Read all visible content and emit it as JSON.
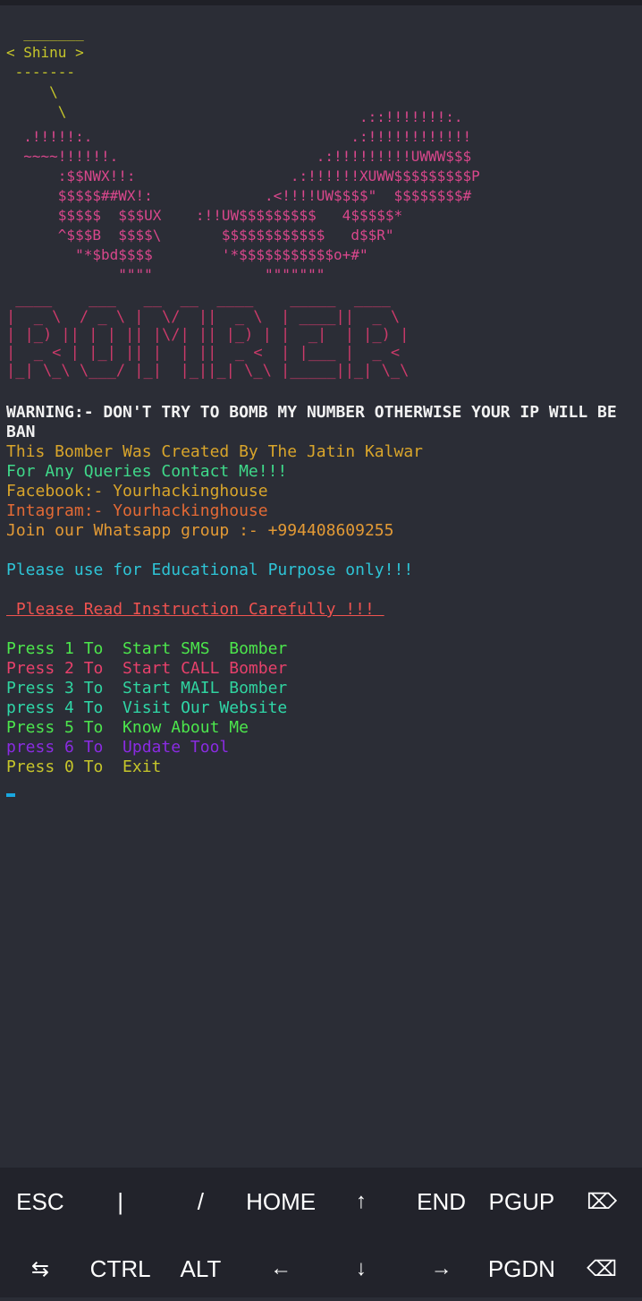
{
  "banner": {
    "cow": "  _______\n< Shinu >\n -------\n     \\\n      \\",
    "skull": "                                         .::!!!!!!!:.\n  .!!!!!:.                              .:!!!!!!!!!!!!\n  ~~~~!!!!!!.                       .:!!!!!!!!!UWWW$$$\n      :$$NWX!!:                  .:!!!!!!XUWW$$$$$$$$$P\n      $$$$$##WX!:             .<!!!!UW$$$$\"  $$$$$$$$#\n      $$$$$  $$$UX    :!!UW$$$$$$$$$   4$$$$$*\n      ^$$$B  $$$$\\       $$$$$$$$$$$$   d$$R\"\n        \"*$bd$$$$        '*$$$$$$$$$$$o+#\"\n             \"\"\"\"             \"\"\"\"\"\"\"",
    "title": " ____    ___   __  __  ____    _____  ____\n|  _ \\  / _ \\ |  \\/  ||  _ \\  | ____||  _ \\\n| |_) || | | || |\\/| || |_) | |  _|  | |_) |\n|  _ < | |_| || |  | ||  _ <  | |___ |  _ <\n|_| \\_\\ \\___/ |_|  |_||_| \\_\\ |_____||_| \\_\\"
  },
  "messages": {
    "warning": "WARNING:- DON'T TRY TO BOMB MY NUMBER OTHERWISE YOUR IP WILL BE BAN",
    "created_by": "This Bomber Was Created By The Jatin Kalwar",
    "queries": "For Any Queries Contact Me!!!",
    "facebook": "Facebook:- Yourhackinghouse",
    "instagram": "Intagram:- Yourhackinghouse",
    "whatsapp": "Join our Whatsapp group :- +994408609255",
    "educational": "Please use for Educational Purpose only!!!",
    "instruction": " Please Read Instruction Carefully !!! "
  },
  "menu": [
    {
      "label": "Press 1 To  Start SMS  Bomber",
      "color": "#4ce64c"
    },
    {
      "label": "Press 2 To  Start CALL Bomber",
      "color": "#e8406b"
    },
    {
      "label": "Press 3 To  Start MAIL Bomber",
      "color": "#2fd4a0"
    },
    {
      "label": "press 4 To  Visit Our Website",
      "color": "#2fd8a8"
    },
    {
      "label": "Press 5 To  Know About Me",
      "color": "#4ce64c"
    },
    {
      "label": "press 6 To  Update Tool",
      "color": "#8a2be2"
    },
    {
      "label": "Press 0 To  Exit",
      "color": "#c6c62a"
    }
  ],
  "extra_keys": {
    "row1": [
      "ESC",
      "|",
      "/",
      "HOME",
      "↑",
      "END",
      "PGUP",
      "⌦"
    ],
    "row2": [
      "⇆",
      "CTRL",
      "ALT",
      "←",
      "↓",
      "→",
      "PGDN",
      "⌫"
    ]
  },
  "colors": {
    "background": "#2b2d36",
    "cow": "#c6c62a",
    "warning": "#f2f2f2",
    "created_by": "#d9a52b",
    "queries": "#3fd98a",
    "facebook": "#d9a52b",
    "instagram": "#e36a35",
    "whatsapp": "#e39a35",
    "educational": "#2ec4d6",
    "instruction": "#ef5350",
    "cursor": "#19a7e0"
  }
}
